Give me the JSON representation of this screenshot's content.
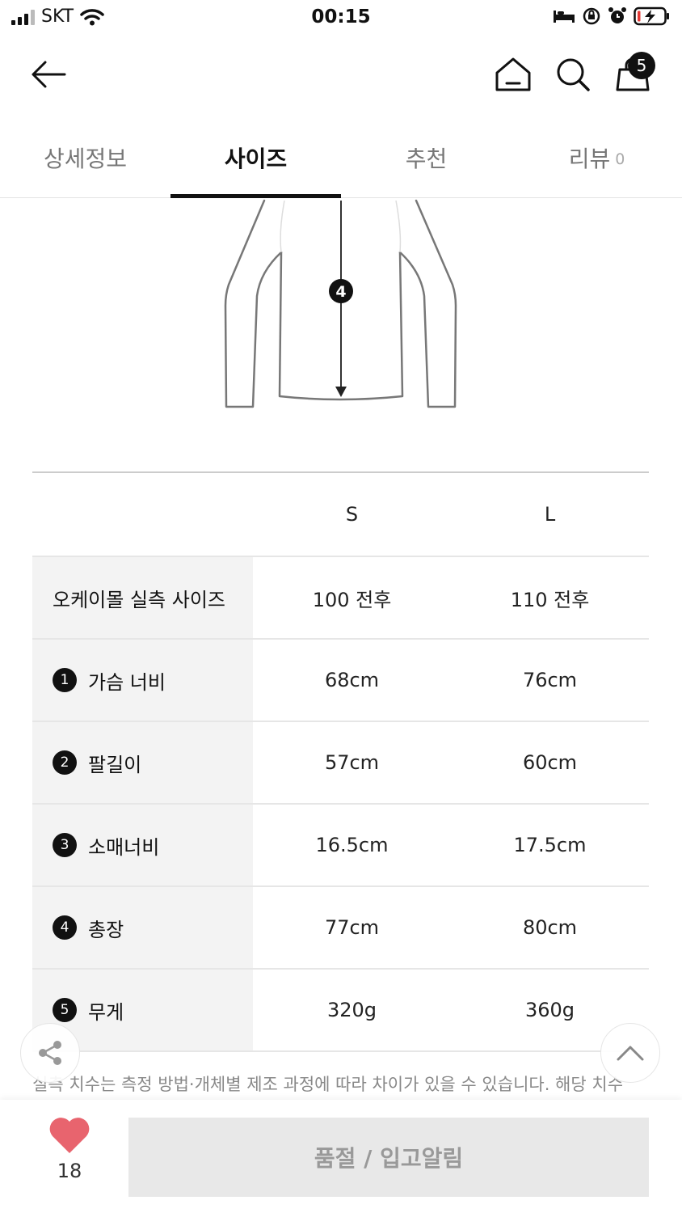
{
  "status_bar": {
    "carrier": "SKT",
    "time": "00:15"
  },
  "header": {
    "cart_count": "5"
  },
  "tabs": [
    {
      "label": "상세정보",
      "active": false
    },
    {
      "label": "사이즈",
      "active": true
    },
    {
      "label": "추천",
      "active": false
    },
    {
      "label": "리뷰",
      "count": "0",
      "active": false
    }
  ],
  "illustration": {
    "marker": "4"
  },
  "size_table": {
    "columns": [
      "S",
      "L"
    ],
    "rows": [
      {
        "num": "",
        "label": "오케이몰 실측 사이즈",
        "values": [
          "100 전후",
          "110 전후"
        ]
      },
      {
        "num": "1",
        "label": "가슴 너비",
        "values": [
          "68cm",
          "76cm"
        ]
      },
      {
        "num": "2",
        "label": "팔길이",
        "values": [
          "57cm",
          "60cm"
        ]
      },
      {
        "num": "3",
        "label": "소매너비",
        "values": [
          "16.5cm",
          "17.5cm"
        ]
      },
      {
        "num": "4",
        "label": "총장",
        "values": [
          "77cm",
          "80cm"
        ]
      },
      {
        "num": "5",
        "label": "무게",
        "values": [
          "320g",
          "360g"
        ]
      }
    ]
  },
  "notice": "실측 치수는 측정 방법·개체별 제조 과정에 따라 차이가 있을 수 있습니다. 해당 치수",
  "bottom_bar": {
    "like_count": "18",
    "soldout_label": "품절 / 입고알림"
  },
  "colors": {
    "heart": "#e8646e",
    "active_tab": "#111111",
    "soldout_bg": "#e8e8e8"
  }
}
